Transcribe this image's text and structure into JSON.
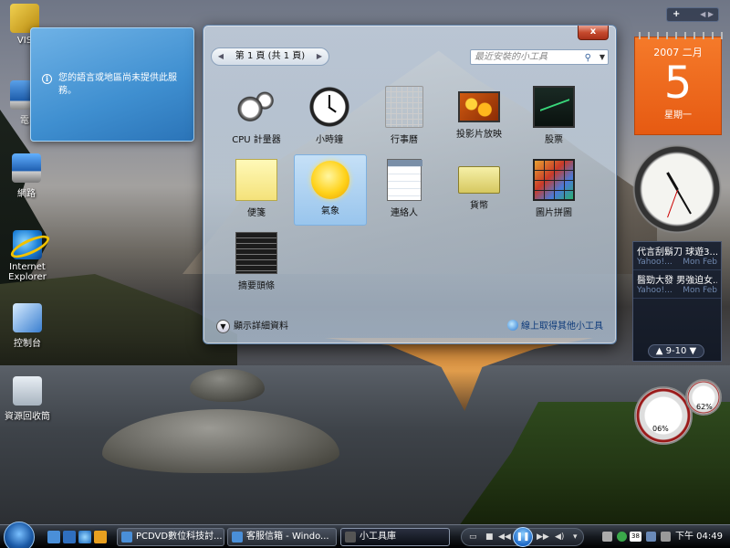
{
  "desktop": {
    "icons": [
      {
        "label": "VIS"
      },
      {
        "label": "電"
      },
      {
        "label": "網路"
      },
      {
        "label": "Internet Explorer"
      },
      {
        "label": "控制台"
      },
      {
        "label": "資源回收筒"
      }
    ]
  },
  "notification": {
    "text": "您的語言或地區尚未提供此服務。"
  },
  "gallery": {
    "close_label": "x",
    "pager_label": "第 1 頁 (共 1 頁)",
    "search_placeholder": "最近安裝的小工具",
    "gadgets": [
      {
        "label": "CPU 計量器",
        "icon": "cpu-meter-icon"
      },
      {
        "label": "小時鐘",
        "icon": "clock-icon"
      },
      {
        "label": "行事曆",
        "icon": "calendar-icon"
      },
      {
        "label": "投影片放映",
        "icon": "slideshow-icon"
      },
      {
        "label": "股票",
        "icon": "stocks-icon"
      },
      {
        "label": "便箋",
        "icon": "notes-icon"
      },
      {
        "label": "氣象",
        "icon": "weather-icon",
        "selected": true
      },
      {
        "label": "連絡人",
        "icon": "contacts-icon"
      },
      {
        "label": "貨幣",
        "icon": "currency-icon"
      },
      {
        "label": "圖片拼圖",
        "icon": "picture-puzzle-icon"
      },
      {
        "label": "摘要頭條",
        "icon": "feed-headlines-icon"
      }
    ],
    "details_label": "顯示詳細資料",
    "online_label": "線上取得其他小工具"
  },
  "sidebar": {
    "add_label": "+",
    "calendar": {
      "year": "2007",
      "month": "二月",
      "day": "5",
      "weekday": "星期一"
    },
    "feeds": [
      {
        "title": "代言刮鬍刀 球遊3...",
        "source": "Yahoo!...",
        "date": "Mon Feb"
      },
      {
        "title": "醫勁大發 男強迫女...",
        "source": "Yahoo!...",
        "date": "Mon Feb"
      }
    ],
    "feed_page": "9-10",
    "cpu_value": "06%",
    "memory_value": "62%"
  },
  "taskbar": {
    "buttons": [
      {
        "label": "PCDVD數位科技討..."
      },
      {
        "label": "客服信箱 - Windo..."
      },
      {
        "label": "小工具庫",
        "active": true
      }
    ],
    "clock": "下午 04:49",
    "tray_number": "38"
  },
  "colors": {
    "calendar_orange": "#e65a12",
    "bubble_blue": "#3f8fd0",
    "taskbar_black": "#15191f"
  }
}
